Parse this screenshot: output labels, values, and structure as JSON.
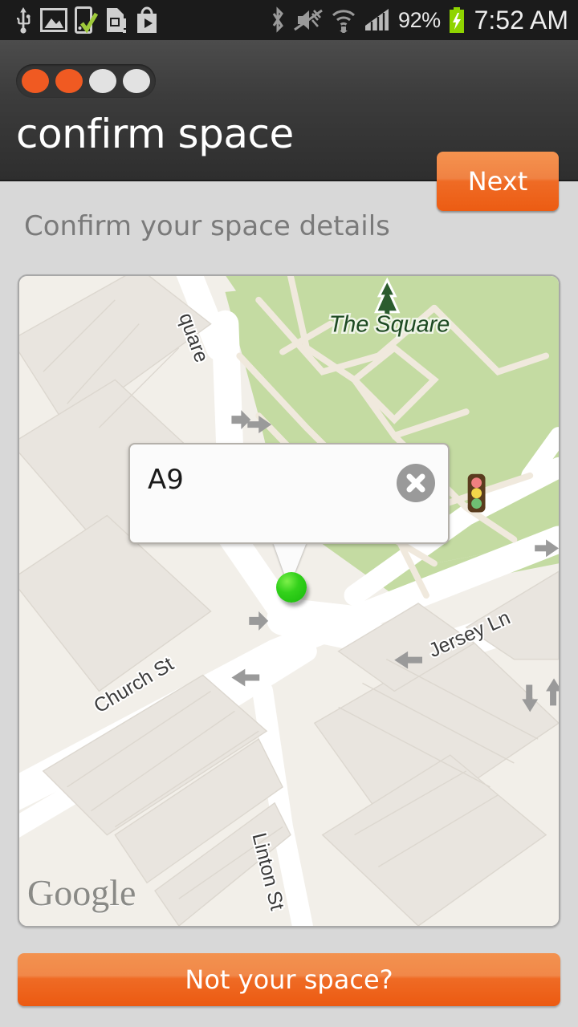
{
  "statusbar": {
    "icons_left": [
      "usb-icon",
      "image-icon",
      "phone-sync-check-icon",
      "sim-card-alert-icon",
      "play-store-icon"
    ],
    "icons_right": [
      "bluetooth-icon",
      "vibrate-off-icon",
      "wifi-icon",
      "signal-bars-icon"
    ],
    "battery_percent": "92%",
    "battery_state": "charging-battery-icon",
    "clock": "7:52 AM"
  },
  "header": {
    "title": "confirm space",
    "next_label": "Next",
    "steps": {
      "total": 4,
      "completed": 2
    },
    "accent_color": "#f05a22"
  },
  "main": {
    "subtitle": "Confirm your space details"
  },
  "map": {
    "attribution": "Google",
    "info_window": {
      "label": "A9",
      "close_icon": "close-circle-icon"
    },
    "marker": {
      "name": "space-marker",
      "color": "#2ecc11"
    },
    "labels": {
      "park": "The Square",
      "street_church": "Church St",
      "street_jersey": "Jersey Ln",
      "street_linton": "Linton St",
      "street_square": "quare",
      "traffic_light": "traffic-light-icon",
      "tree": "tree-icon"
    },
    "colors": {
      "land": "#f2efe9",
      "park": "#c4dba2",
      "road": "#ffffff",
      "building": "#e9e5df",
      "path": "#f0e9dd"
    }
  },
  "footer": {
    "not_your_space_label": "Not your space?"
  }
}
